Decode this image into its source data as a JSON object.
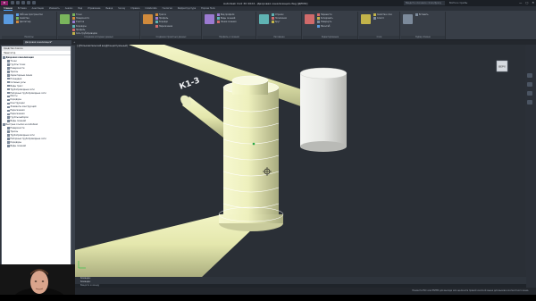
{
  "app": {
    "logo": "C",
    "title": "Autodesk Civil 3D 2024 - Дворовая канализация.dwg [ДЕМО]",
    "search_placeholder": "Введите ключевое слово/фразу",
    "user": "Войти в службы",
    "window_buttons": [
      "—",
      "▢",
      "✕"
    ]
  },
  "tabs": [
    "Главная",
    "Вставка",
    "Аннотации",
    "Изменить",
    "Анализ",
    "Вид",
    "Управление",
    "Вывод",
    "Survey",
    "Справка",
    "Collaborate",
    "Геология",
    "Инфраструктура",
    "Express Tools"
  ],
  "active_tab": "Главная",
  "ribbon": {
    "groups": [
      {
        "title": "Палитры",
        "rows": [
          "Рабочее пространство",
          "Свойства",
          "Диспетчер"
        ]
      },
      {
        "title": "Создание исходных данных",
        "rows": [
          "Точки",
          "Поверхности",
          "Участки",
          "Коридоры",
          "Профиль",
          "Сеть трубопроводов"
        ]
      },
      {
        "title": "Создание проектных данных",
        "rows": [
          "Трасса",
          "Профиль",
          "Коридор",
          "Пересечение"
        ]
      },
      {
        "title": "Профиль и сечения",
        "rows": [
          "Вид профиля",
          "Виды сечений",
          "Линии сечения"
        ]
      },
      {
        "title": "Рисование",
        "rows": [
          "Отрезок",
          "Полилиния",
          "Круг"
        ]
      },
      {
        "title": "Редактирование",
        "rows": [
          "Перенести",
          "Копировать",
          "Повернуть",
          "Масштаб"
        ]
      },
      {
        "title": "Слои",
        "rows": [
          "Свойства слоя",
          "Слой 0"
        ]
      },
      {
        "title": "Буфер обмена",
        "rows": [
          "Вставить"
        ]
      }
    ]
  },
  "file_tab": "Дворовая канализация*",
  "toolspace": {
    "header": "Средство поиска",
    "selector": "Навигатор",
    "items": [
      {
        "label": "Дворовая канализация",
        "level": 0,
        "root": true
      },
      {
        "label": "Точки",
        "level": 1
      },
      {
        "label": "Группы точек",
        "level": 1
      },
      {
        "label": "Поверхности",
        "level": 1
      },
      {
        "label": "Трассы",
        "level": 1
      },
      {
        "label": "Характерные линии",
        "level": 1
      },
      {
        "label": "Площадки",
        "level": 1
      },
      {
        "label": "Сетевые узлы",
        "level": 1
      },
      {
        "label": "Виды трасс",
        "level": 1
      },
      {
        "label": "Трубопроводные сети",
        "level": 1
      },
      {
        "label": "Напорные трубопроводные сети",
        "level": 1
      },
      {
        "label": "Мосты",
        "level": 1
      },
      {
        "label": "Коридоры",
        "level": 1
      },
      {
        "label": "Конструкции",
        "level": 1
      },
      {
        "label": "Элементы конструкций",
        "level": 1
      },
      {
        "label": "Пересечения",
        "level": 1
      },
      {
        "label": "Пересечения",
        "level": 1
      },
      {
        "label": "Группы выборок",
        "level": 1
      },
      {
        "label": "Виды сечений",
        "level": 1
      },
      {
        "label": "Быстрые ссылки на Autodesk",
        "level": 0
      },
      {
        "label": "Поверхности",
        "level": 1
      },
      {
        "label": "Трассы",
        "level": 1
      },
      {
        "label": "Трубопроводные сети",
        "level": 1
      },
      {
        "label": "Напорные трубопроводные сети",
        "level": 1
      },
      {
        "label": "Коридоры",
        "level": 1
      },
      {
        "label": "Виды сечений",
        "level": 1
      }
    ]
  },
  "viewport": {
    "label": "[-][Пользовательский вид][Концептуальный]",
    "annotation": "К1-3",
    "viewcube": "ВЕРХ"
  },
  "command": {
    "history": [
      "Команда:",
      "Команда:"
    ],
    "placeholder": "Введите команду"
  },
  "status": {
    "message": "Нажмите ESC или ENTER для выхода или щелкните правой кнопкой мыши для вызова контекстного меню."
  },
  "colors": {
    "pipe": "#e9ecb7",
    "background": "#2a2f36",
    "ribbon": "#383e47",
    "accent": "#4aa3ff"
  }
}
